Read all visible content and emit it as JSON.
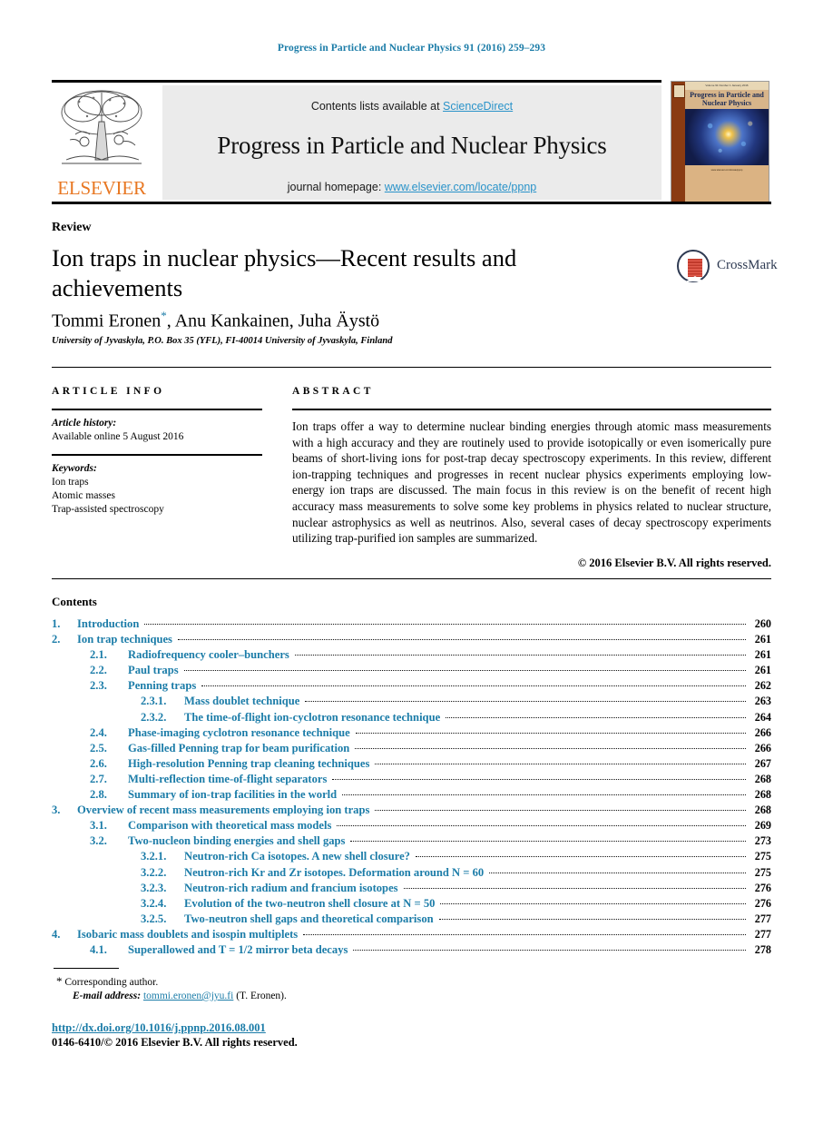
{
  "running_head": "Progress in Particle and Nuclear Physics 91 (2016) 259–293",
  "banner": {
    "contents_prefix": "Contents lists available at ",
    "sciencedirect_link": "ScienceDirect",
    "journal_name": "Progress in Particle and Nuclear Physics",
    "homepage_prefix": "journal homepage: ",
    "homepage_link": "www.elsevier.com/locate/ppnp",
    "publisher_logo_text": "ELSEVIER",
    "cover_title": "Progress in Particle and Nuclear Physics",
    "cover_top_strip": "Volume 91   Number 1   January 2016",
    "cover_footer": "www.elsevier.com/locate/ppnp",
    "accent_blue": "#2a93c9",
    "elsevier_orange": "#e87722"
  },
  "article": {
    "type_label": "Review",
    "title": "Ion traps in nuclear physics—Recent results and achievements",
    "authors": "Tommi Eronen",
    "corresponding_marker": "*",
    "authors_rest": ", Anu Kankainen, Juha Äystö",
    "affiliation": "University of Jyvaskyla, P.O. Box 35 (YFL), FI-40014 University of Jyvaskyla, Finland",
    "crossmark_label": "CrossMark",
    "link_blue": "#1b7ca8"
  },
  "article_info": {
    "heading": "ARTICLE INFO",
    "history_label": "Article history:",
    "history_value": "Available online 5 August 2016",
    "keywords_label": "Keywords:",
    "keywords": [
      "Ion traps",
      "Atomic masses",
      "Trap-assisted spectroscopy"
    ]
  },
  "abstract": {
    "heading": "ABSTRACT",
    "body": "Ion traps offer a way to determine nuclear binding energies through atomic mass measurements with a high accuracy and they are routinely used to provide isotopically or even isomerically pure beams of short-living ions for post-trap decay spectroscopy experiments. In this review, different ion-trapping techniques and progresses in recent nuclear physics experiments employing low-energy ion traps are discussed. The main focus in this review is on the benefit of recent high accuracy mass measurements to solve some key problems in physics related to nuclear structure, nuclear astrophysics as well as neutrinos. Also, several cases of decay spectroscopy experiments utilizing trap-purified ion samples are summarized.",
    "copyright": "© 2016 Elsevier B.V. All rights reserved."
  },
  "contents": {
    "heading": "Contents",
    "entries": [
      {
        "level": 1,
        "num": "1.",
        "label": "Introduction",
        "page": "260"
      },
      {
        "level": 1,
        "num": "2.",
        "label": "Ion trap techniques",
        "page": "261"
      },
      {
        "level": 2,
        "num": "2.1.",
        "label": "Radiofrequency cooler–bunchers",
        "page": "261"
      },
      {
        "level": 2,
        "num": "2.2.",
        "label": "Paul traps",
        "page": "261"
      },
      {
        "level": 2,
        "num": "2.3.",
        "label": "Penning traps",
        "page": "262"
      },
      {
        "level": 3,
        "num": "2.3.1.",
        "label": "Mass doublet technique",
        "page": "263"
      },
      {
        "level": 3,
        "num": "2.3.2.",
        "label": "The time-of-flight ion-cyclotron resonance technique",
        "page": "264"
      },
      {
        "level": 2,
        "num": "2.4.",
        "label": "Phase-imaging cyclotron resonance technique",
        "page": "266"
      },
      {
        "level": 2,
        "num": "2.5.",
        "label": "Gas-filled Penning trap for beam purification",
        "page": "266"
      },
      {
        "level": 2,
        "num": "2.6.",
        "label": "High-resolution Penning trap cleaning techniques",
        "page": "267"
      },
      {
        "level": 2,
        "num": "2.7.",
        "label": "Multi-reflection time-of-flight separators",
        "page": "268"
      },
      {
        "level": 2,
        "num": "2.8.",
        "label": "Summary of ion-trap facilities in the world",
        "page": "268"
      },
      {
        "level": 1,
        "num": "3.",
        "label": "Overview of recent mass measurements employing ion traps",
        "page": "268"
      },
      {
        "level": 2,
        "num": "3.1.",
        "label": "Comparison with theoretical mass models",
        "page": "269"
      },
      {
        "level": 2,
        "num": "3.2.",
        "label": "Two-nucleon binding energies and shell gaps",
        "page": "273"
      },
      {
        "level": 3,
        "num": "3.2.1.",
        "label": "Neutron-rich Ca isotopes. A new shell closure?",
        "page": "275"
      },
      {
        "level": 3,
        "num": "3.2.2.",
        "label": "Neutron-rich Kr and Zr isotopes. Deformation around N = 60",
        "page": "275"
      },
      {
        "level": 3,
        "num": "3.2.3.",
        "label": "Neutron-rich radium and francium isotopes",
        "page": "276"
      },
      {
        "level": 3,
        "num": "3.2.4.",
        "label": "Evolution of the two-neutron shell closure at N = 50",
        "page": "276"
      },
      {
        "level": 3,
        "num": "3.2.5.",
        "label": "Two-neutron shell gaps and theoretical comparison",
        "page": "277"
      },
      {
        "level": 1,
        "num": "4.",
        "label": "Isobaric mass doublets and isospin multiplets",
        "page": "277"
      },
      {
        "level": 2,
        "num": "4.1.",
        "label": "Superallowed and T = 1/2 mirror beta decays",
        "page": "278"
      }
    ]
  },
  "footer": {
    "corresponding_star": "*",
    "corresponding_text": "Corresponding author.",
    "email_label": "E-mail address:",
    "email": "tommi.eronen@jyu.fi",
    "email_suffix": "(T. Eronen).",
    "doi": "http://dx.doi.org/10.1016/j.ppnp.2016.08.001",
    "issn_copyright": "0146-6410/© 2016 Elsevier B.V. All rights reserved."
  }
}
